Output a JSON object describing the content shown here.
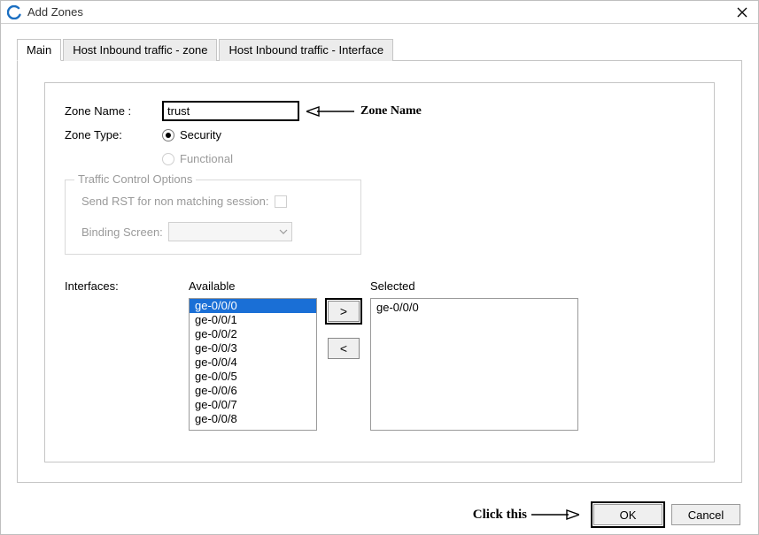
{
  "titlebar": {
    "title": "Add Zones"
  },
  "tabs": [
    {
      "label": "Main",
      "active": true
    },
    {
      "label": "Host Inbound traffic - zone",
      "active": false
    },
    {
      "label": "Host Inbound traffic - Interface",
      "active": false
    }
  ],
  "form": {
    "zone_name_label": "Zone Name :",
    "zone_name_value": "trust",
    "zone_type_label": "Zone Type:",
    "zone_type_options": {
      "security_label": "Security",
      "functional_label": "Functional"
    },
    "zone_type_selected": "Security"
  },
  "traffic_group": {
    "title": "Traffic Control Options",
    "send_rst_label": "Send RST for non matching session:",
    "send_rst_checked": false,
    "binding_label": "Binding Screen:",
    "binding_value": ""
  },
  "interfaces": {
    "label": "Interfaces:",
    "available_label": "Available",
    "selected_label": "Selected",
    "available": [
      "ge-0/0/0",
      "ge-0/0/1",
      "ge-0/0/2",
      "ge-0/0/3",
      "ge-0/0/4",
      "ge-0/0/5",
      "ge-0/0/6",
      "ge-0/0/7",
      "ge-0/0/8"
    ],
    "available_selected_index": 0,
    "selected": [
      "ge-0/0/0"
    ],
    "move_right_label": ">",
    "move_left_label": "<"
  },
  "annotations": {
    "zone_name_hint": "Zone Name",
    "click_this": "Click this"
  },
  "buttons": {
    "ok": "OK",
    "cancel": "Cancel"
  }
}
